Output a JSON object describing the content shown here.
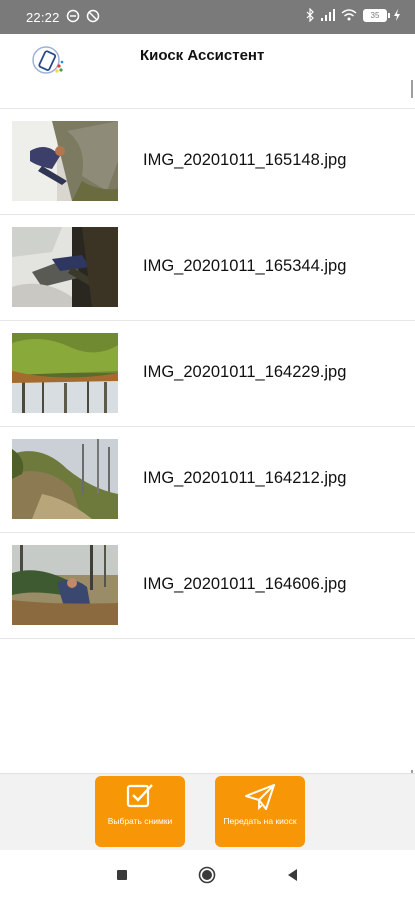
{
  "status_bar": {
    "time": "22:22",
    "battery": "35"
  },
  "app": {
    "title": "Киоск Ассистент",
    "logo_icon": "kiosk-phone-icon"
  },
  "files": [
    {
      "name": "IMG_20201011_165148.jpg"
    },
    {
      "name": "IMG_20201011_165344.jpg"
    },
    {
      "name": "IMG_20201011_164229.jpg"
    },
    {
      "name": "IMG_20201011_164212.jpg"
    },
    {
      "name": "IMG_20201011_164606.jpg"
    }
  ],
  "actions": {
    "select": {
      "label": "Выбрать снимки",
      "icon": "checkbox-icon"
    },
    "send": {
      "label": "Передать на киоск",
      "icon": "paper-plane-icon"
    }
  },
  "colors": {
    "accent": "#f79708",
    "status_bar": "#7a7a7a"
  }
}
